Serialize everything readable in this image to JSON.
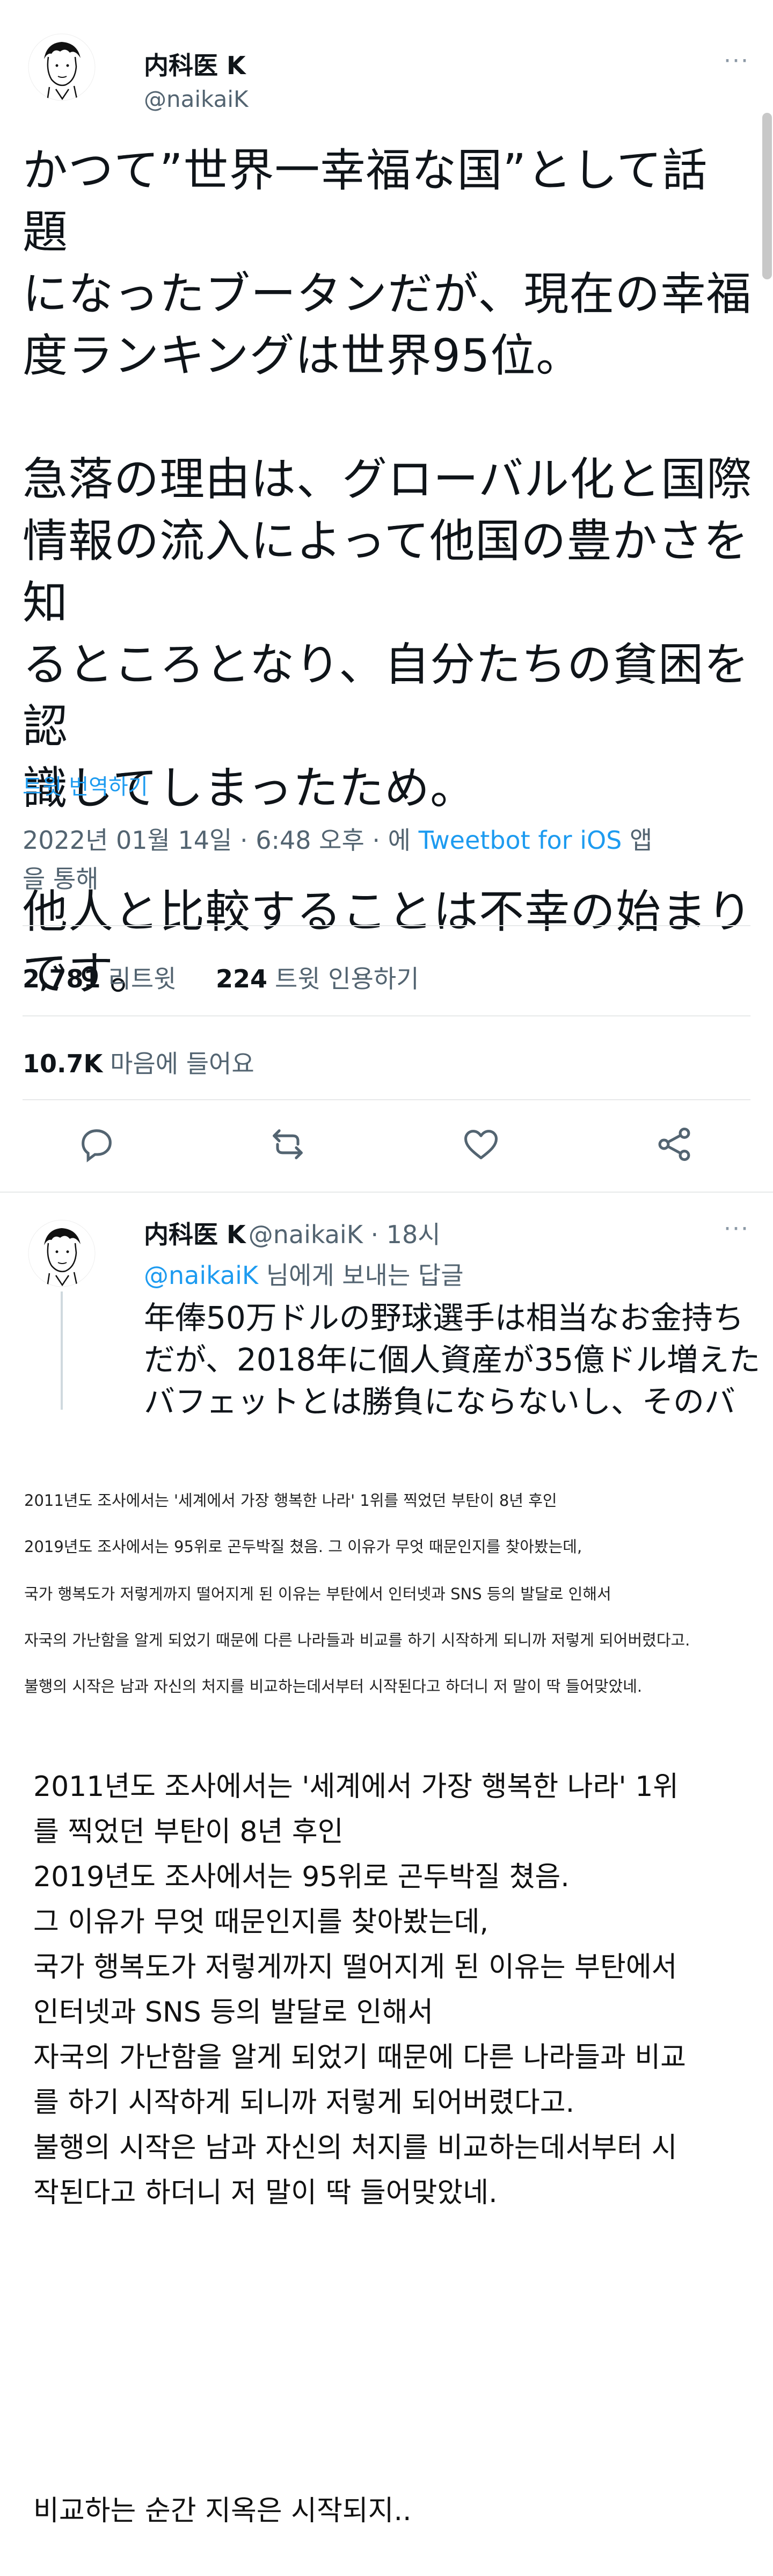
{
  "tweet": {
    "author_name": "内科医 K",
    "author_handle": "@naikaiK",
    "more_label": "···",
    "text": "かつて”世界一幸福な国”として話題\nになったブータンだが、現在の幸福\n度ランキングは世界95位。\n\n急落の理由は、グローバル化と国際\n情報の流入によって他国の豊かさを知\nるところとなり、自分たちの貧困を認\n識してしまったため。\n\n他人と比較することは不幸の始まり\nです。",
    "translate_label": "트윗 번역하기",
    "timestamp_prefix": "2022년 01월 14일 · 6:48 오후 · 에 ",
    "timestamp_app": "Tweetbot for iOS",
    "timestamp_suffix": " 앱\n을 통해",
    "retweets_count": "2,781",
    "retweets_label": "리트윗",
    "quotes_count": "224",
    "quotes_label": "트윗 인용하기",
    "likes_count": "10.7K",
    "likes_label": "마음에 들어요",
    "icons": [
      "reply-icon",
      "retweet-icon",
      "like-icon",
      "share-icon"
    ]
  },
  "reply": {
    "author_name": "内科医 K",
    "meta": "@naikaiK · 18시",
    "reply_mention": "@naikaiK",
    "reply_suffix": " 님에게 보내는 답글",
    "body": "年俸50万ドルの野球選手は相当なお金持ち\nだが、2018年に個人資産が35億ドル増えた\nバフェットとは勝負にならないし、そのバ"
  },
  "captions": [
    "2011년도 조사에서는 '세계에서 가장 행복한 나라' 1위를 찍었던 부탄이 8년 후인",
    "2019년도 조사에서는 95위로 곤두박질 쳤음. 그 이유가 무엇 때문인지를 찾아봤는데,",
    "국가 행복도가 저렇게까지 떨어지게 된 이유는 부탄에서 인터넷과 SNS 등의 발달로 인해서",
    "자국의 가난함을 알게 되었기 때문에 다른 나라들과 비교를 하기 시작하게 되니까 저렇게 되어버렸다고.",
    "불행의 시작은 남과 자신의 처지를 비교하는데서부터 시작된다고 하더니 저 말이 딱 들어맞았네."
  ],
  "body": {
    "paragraph": "2011년도 조사에서는 '세계에서 가장 행복한 나라' 1위\n를 찍었던 부탄이 8년 후인\n2019년도 조사에서는 95위로 곤두박질 쳤음.\n그 이유가 무엇 때문인지를 찾아봤는데,\n국가 행복도가 저렇게까지 떨어지게 된 이유는 부탄에서\n인터넷과 SNS 등의 발달로 인해서\n자국의 가난함을 알게 되었기 때문에 다른 나라들과 비교\n를 하기 시작하게 되니까 저렇게 되어버렸다고.\n불행의 시작은 남과 자신의 처지를 비교하는데서부터 시\n작된다고 하더니 저 말이 딱 들어맞았네.",
    "closing": "비교하는 순간 지옥은 시작되지.."
  },
  "colors": {
    "link_blue": "#1d9bf0",
    "secondary_gray": "#536471",
    "text_dark": "#0f1419",
    "like_red": "#f91880"
  }
}
